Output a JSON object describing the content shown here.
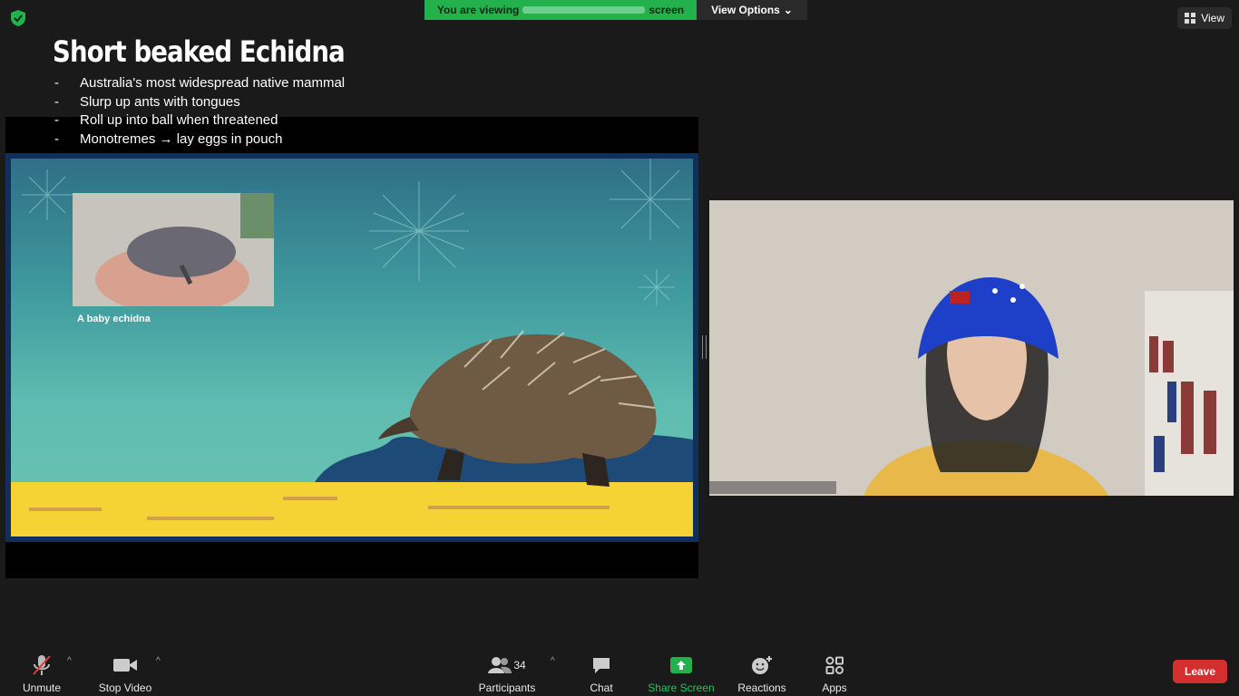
{
  "top": {
    "banner_prefix": "You are viewing",
    "banner_suffix": "screen",
    "view_options": "View Options",
    "view": "View"
  },
  "slide": {
    "title": "Short beaked Echidna",
    "bullets": [
      "Australia's most widespread native mammal",
      "Slurp up ants with tongues",
      "Roll up into ball when threatened",
      "Monotremes → lay eggs in pouch"
    ],
    "bullet_marker": "-",
    "caption": "A baby echidna"
  },
  "toolbar": {
    "unmute": "Unmute",
    "stop_video": "Stop Video",
    "participants": "Participants",
    "participant_count": "34",
    "chat": "Chat",
    "share_screen": "Share Screen",
    "reactions": "Reactions",
    "apps": "Apps",
    "leave": "Leave"
  },
  "colors": {
    "share_green": "#22b14c",
    "leave_red": "#d32f2f",
    "slide_ground": "#f5d335"
  }
}
